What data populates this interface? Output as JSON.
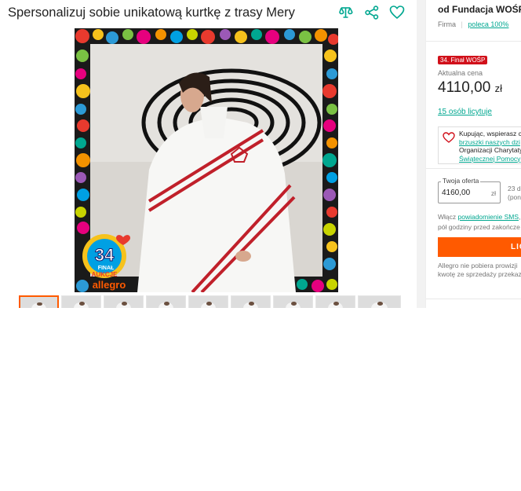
{
  "title": "Spersonalizuj sobie unikatową kurtkę z trasy Mery",
  "icons": [
    "compare-icon",
    "share-icon",
    "heart-icon"
  ],
  "photo": {
    "badge_number": "34",
    "badge_text1": "FINAŁ",
    "badge_text2": "AUKCJE",
    "badge_brand": "allegro"
  },
  "thumbnails_count": 9,
  "seller": {
    "name": "od Fundacja WOŚP",
    "type": "Firma",
    "recommend": "poleca 100%"
  },
  "badge": "34. Finał WOŚP",
  "price": {
    "label": "Aktualna cena",
    "value": "4110,00",
    "currency": "zł"
  },
  "bids": "15 osób licytuje",
  "charity": {
    "line1": "Kupując, wspierasz c",
    "line2": "brzuszki naszych dzi",
    "line3": "Organizacji Charytaty",
    "line4": "Świątecznej Pomocy"
  },
  "offer": {
    "label": "Twoja oferta",
    "value": "4160,00",
    "currency": "zł",
    "note1": "23 d",
    "note2": "(pon"
  },
  "sms": {
    "prefix": "Włącz ",
    "link": "powiadomienie SMS",
    "suffix": ",",
    "line2": "pół godziny przed zakończe"
  },
  "bid_button": "LIC",
  "fee": {
    "line1": "Allegro nie pobiera prowizji",
    "line2": "kwotę ze sprzedaży przekaz"
  },
  "colors": {
    "accent": "#ff5a00",
    "link": "#00a790",
    "badge": "#d1101a"
  }
}
